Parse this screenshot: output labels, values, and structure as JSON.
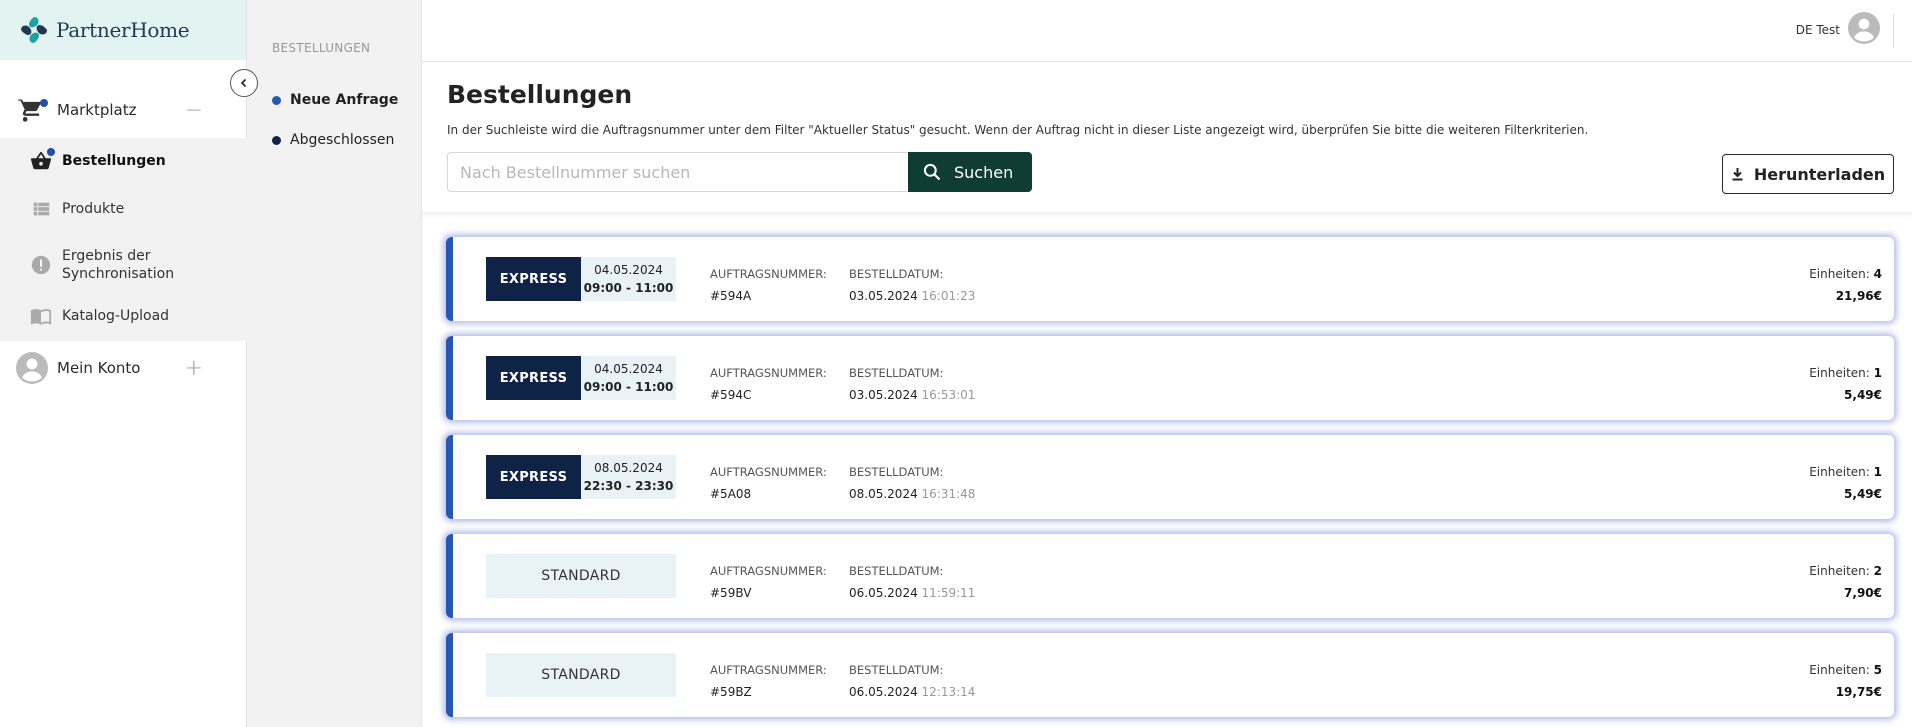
{
  "app": {
    "name": "PartnerHome"
  },
  "sidebar": {
    "marketplace": {
      "label": "Marktplatz",
      "toggle": "−"
    },
    "items": [
      {
        "label": "Bestellungen",
        "icon": "basket-icon"
      },
      {
        "label": "Produkte",
        "icon": "list-icon"
      },
      {
        "label": "Ergebnis der Synchronisation",
        "icon": "alert-circle-icon"
      },
      {
        "label": "Katalog-Upload",
        "icon": "catalog-icon"
      }
    ],
    "account": {
      "label": "Mein Konto",
      "toggle": "+"
    }
  },
  "subnav": {
    "title": "BESTELLUNGEN",
    "items": [
      {
        "label": "Neue Anfrage",
        "color": "#2756b3"
      },
      {
        "label": "Abgeschlossen",
        "color": "#0f2347"
      }
    ]
  },
  "header": {
    "user": "DE Test"
  },
  "main": {
    "title": "Bestellungen",
    "description": "In der Suchleiste wird die Auftragsnummer unter dem Filter \"Aktueller Status\" gesucht. Wenn der Auftrag nicht in dieser Liste angezeigt wird, überprüfen Sie bitte die weiteren Filterkriterien.",
    "search_placeholder": "Nach Bestellnummer suchen",
    "search_label": "Suchen",
    "download_label": "Herunterladen"
  },
  "labels": {
    "order_number": "AUFTRAGSNUMMER:",
    "order_date": "BESTELLDATUM:",
    "units": "Einheiten:"
  },
  "orders": [
    {
      "type": "EXPRESS",
      "slot_date": "04.05.2024",
      "slot_time": "09:00 - 11:00",
      "number": "#594A",
      "date": "03.05.2024",
      "time": "16:01:23",
      "units": "4",
      "price": "21,96€"
    },
    {
      "type": "EXPRESS",
      "slot_date": "04.05.2024",
      "slot_time": "09:00 - 11:00",
      "number": "#594C",
      "date": "03.05.2024",
      "time": "16:53:01",
      "units": "1",
      "price": "5,49€"
    },
    {
      "type": "EXPRESS",
      "slot_date": "08.05.2024",
      "slot_time": "22:30 - 23:30",
      "number": "#5A08",
      "date": "08.05.2024",
      "time": "16:31:48",
      "units": "1",
      "price": "5,49€"
    },
    {
      "type": "STANDARD",
      "number": "#59BV",
      "date": "06.05.2024",
      "time": "11:59:11",
      "units": "2",
      "price": "7,90€"
    },
    {
      "type": "STANDARD",
      "number": "#59BZ",
      "date": "06.05.2024",
      "time": "12:13:14",
      "units": "5",
      "price": "19,75€"
    }
  ],
  "colors": {
    "accent": "#2756b3",
    "express": "#0f2347",
    "search_button": "#0f3c34",
    "logo_bg": "#e3f3f1"
  }
}
